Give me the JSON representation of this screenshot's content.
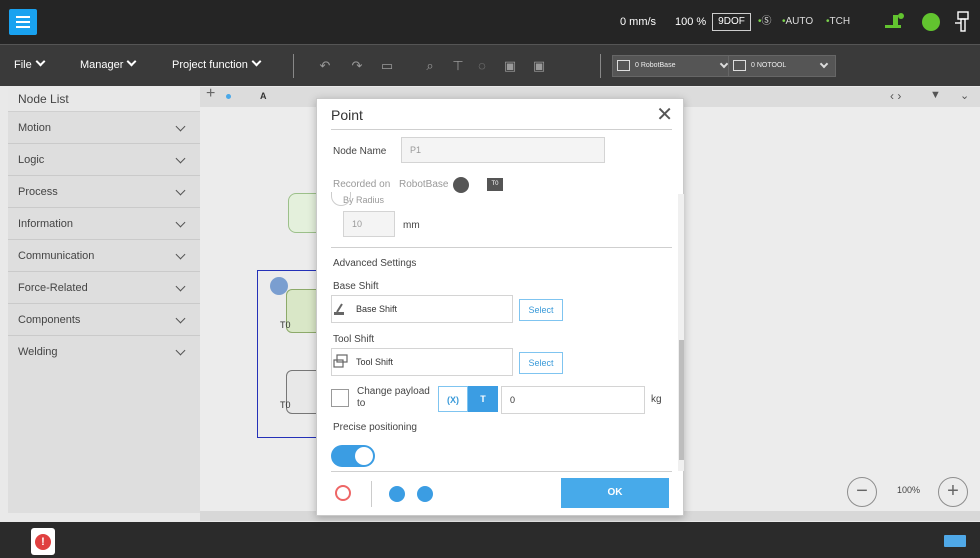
{
  "topbar": {
    "speed": "0 mm/s",
    "override": "100 %",
    "dof": "9DOF",
    "mode_s": "Ⓢ",
    "mode_auto": "AUTO",
    "mode_tch": "TCH"
  },
  "menubar": {
    "file": "File",
    "manager": "Manager",
    "project_function": "Project function",
    "coord_base": "0 RobotBase",
    "coord_tool": "0 NOTOOL"
  },
  "sidebar": {
    "title": "Node List",
    "items": [
      {
        "label": "Motion"
      },
      {
        "label": "Logic"
      },
      {
        "label": "Process"
      },
      {
        "label": "Information"
      },
      {
        "label": "Communication"
      },
      {
        "label": "Force-Related"
      },
      {
        "label": "Components"
      },
      {
        "label": "Welding"
      }
    ]
  },
  "canvas": {
    "tab_label": "A",
    "node1_label": "T0",
    "node2_label": "T0",
    "zoom": "100%"
  },
  "dialog": {
    "title": "Point",
    "node_name_label": "Node Name",
    "node_name_value": "P1",
    "recorded_on_label": "Recorded on",
    "recorded_on_value": "RobotBase",
    "recorded_tag": "T0",
    "by_radius": "By Radius",
    "radius_value": "10",
    "radius_unit": "mm",
    "advanced_settings": "Advanced Settings",
    "base_shift_label": "Base Shift",
    "base_shift_value": "Base Shift",
    "tool_shift_label": "Tool Shift",
    "tool_shift_value": "Tool Shift",
    "select": "Select",
    "change_payload": "Change payload\nto",
    "seg_x": "(X)",
    "seg_t": "T",
    "payload_value": "0",
    "payload_unit": "kg",
    "precise_positioning": "Precise positioning",
    "precise_positioning_on": true,
    "ok": "OK"
  },
  "colors": {
    "accent": "#3b9de3",
    "topbar": "#252525",
    "menubar": "#3a3a3a",
    "status_green": "#62c42f",
    "alert": "#e04040"
  }
}
